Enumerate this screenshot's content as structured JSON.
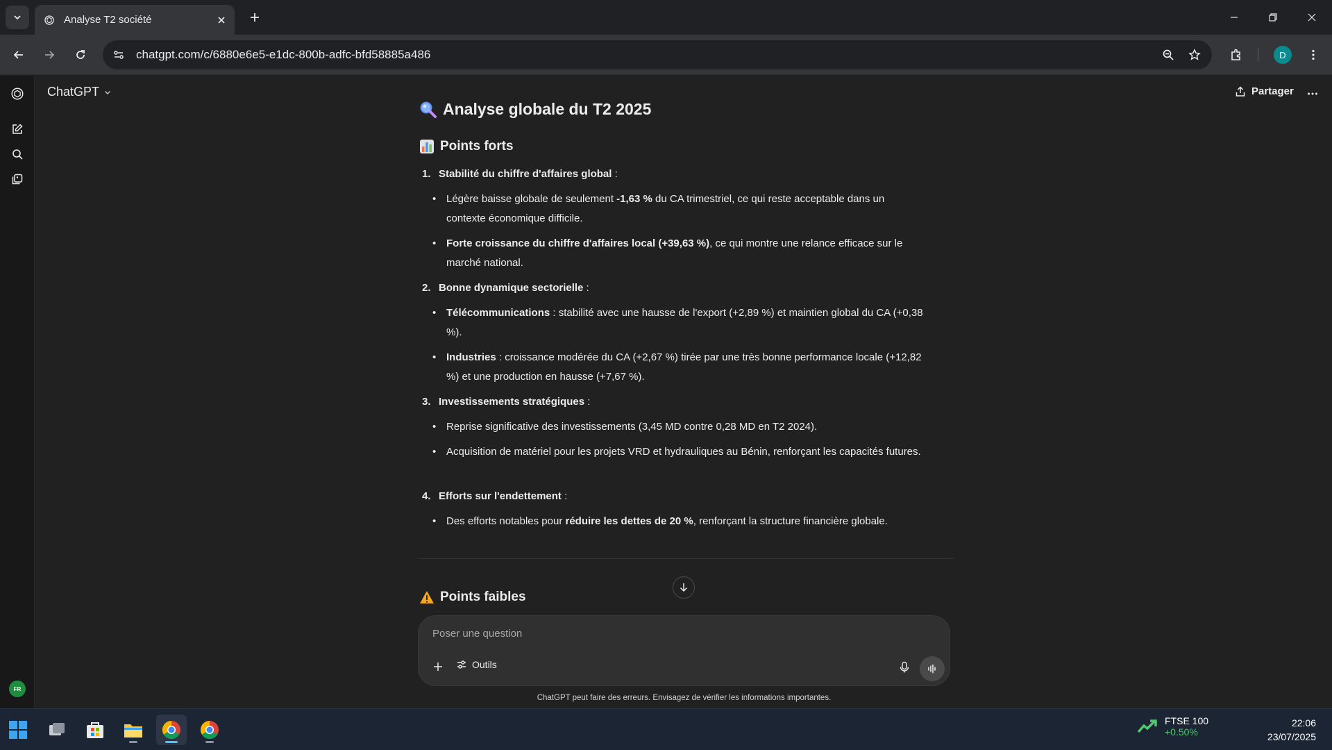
{
  "browser": {
    "tab_title": "Analyse T2 société",
    "url": "chatgpt.com/c/6880e6e5-e1dc-800b-adfc-bfd58885a486",
    "profile_initial": "D"
  },
  "app": {
    "model_label": "ChatGPT",
    "share_label": "Partager",
    "language_badge": "FR"
  },
  "doc": {
    "title": "Analyse globale du T2 2025",
    "strengths_heading": "Points forts",
    "items": [
      {
        "num": "1.",
        "title": "Stabilité du chiffre d'affaires global",
        "suffix": " :",
        "bullets": [
          {
            "pre": "Légère baisse globale de seulement ",
            "bold": "-1,63 %",
            "post": " du CA trimestriel, ce qui reste acceptable dans un contexte économique difficile."
          },
          {
            "pre": "",
            "bold": "Forte croissance du chiffre d'affaires local (+39,63 %)",
            "post": ", ce qui montre une relance efficace sur le marché national."
          }
        ]
      },
      {
        "num": "2.",
        "title": "Bonne dynamique sectorielle",
        "suffix": " :",
        "bullets": [
          {
            "pre": "",
            "bold": "Télécommunications",
            "post": " : stabilité avec une hausse de l'export (+2,89 %) et maintien global du CA (+0,38 %)."
          },
          {
            "pre": "",
            "bold": "Industries",
            "post": " : croissance modérée du CA (+2,67 %) tirée par une très bonne performance locale (+12,82 %) et une production en hausse (+7,67 %)."
          }
        ]
      },
      {
        "num": "3.",
        "title": "Investissements stratégiques",
        "suffix": " :",
        "bullets": [
          {
            "pre": "Reprise significative des investissements (3,45 MD contre 0,28 MD en T2 2024).",
            "bold": "",
            "post": ""
          },
          {
            "pre": "Acquisition de matériel pour les projets VRD et hydrauliques au Bénin, renforçant les capacités futures.",
            "bold": "",
            "post": ""
          }
        ]
      },
      {
        "num": "4.",
        "title": "Efforts sur l'endettement",
        "suffix": " :",
        "bullets": [
          {
            "pre": "Des efforts notables pour ",
            "bold": "réduire les dettes de 20 %",
            "post": ", renforçant la structure financière globale."
          }
        ]
      }
    ],
    "weaknesses_heading": "Points faibles"
  },
  "composer": {
    "placeholder": "Poser une question",
    "tools_label": "Outils"
  },
  "disclaimer": "ChatGPT peut faire des erreurs. Envisagez de vérifier les informations importantes.",
  "taskbar": {
    "ticker_name": "FTSE 100",
    "ticker_change": "+0.50%",
    "time": "22:06",
    "date": "23/07/2025"
  },
  "colors": {
    "background": "#212121",
    "toolbar": "#35363a",
    "taskbar": "#1c2534",
    "ticker_up": "#4ec96b",
    "accent_profile": "#0b8a8f"
  }
}
